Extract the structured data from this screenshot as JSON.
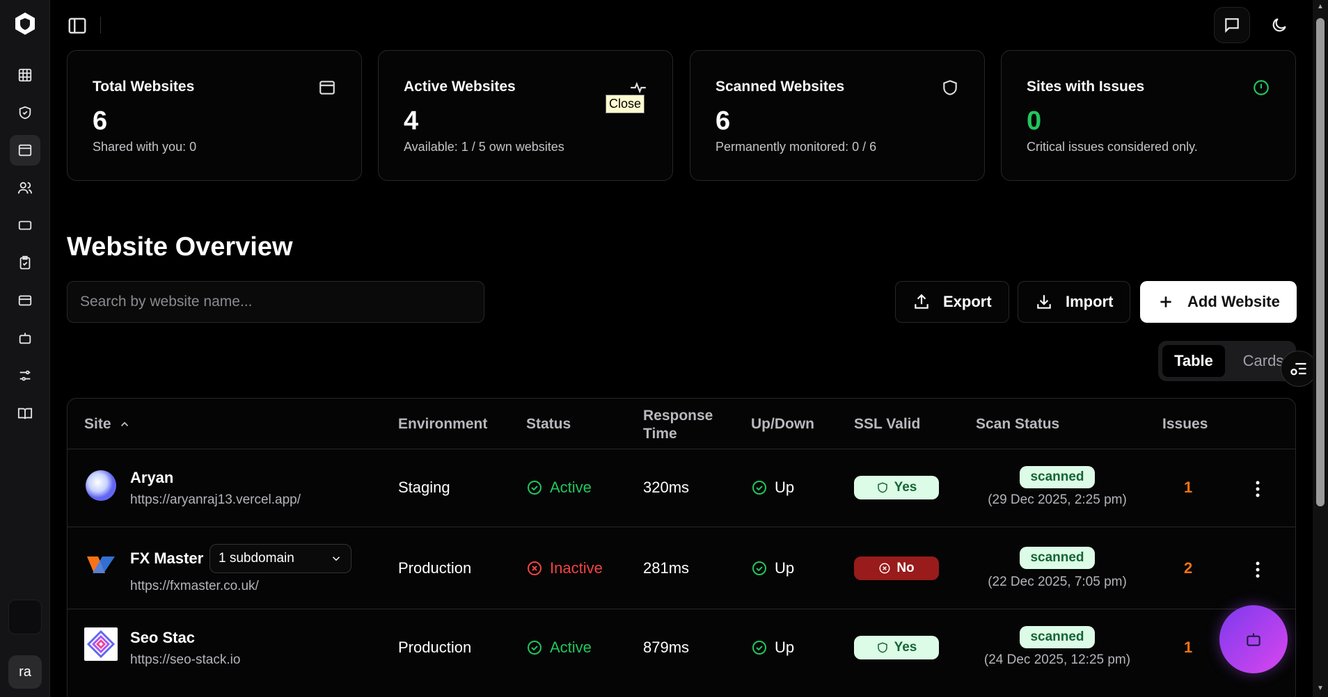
{
  "sidebar": {
    "items": [
      "dashboard",
      "security",
      "websites",
      "users",
      "tickets",
      "tasks",
      "billing",
      "bots",
      "settings",
      "docs"
    ],
    "bottom_box_text": "",
    "avatar_initials": "ra"
  },
  "stats": [
    {
      "title": "Total Websites",
      "value": "6",
      "sub": "Shared with you: 0"
    },
    {
      "title": "Active Websites",
      "value": "4",
      "sub": "Available: 1 / 5 own websites"
    },
    {
      "title": "Scanned Websites",
      "value": "6",
      "sub": "Permanently monitored: 0 / 6"
    },
    {
      "title": "Sites with Issues",
      "value": "0",
      "sub": "Critical issues considered only."
    }
  ],
  "tooltip": "Close",
  "page_title": "Website Overview",
  "search": {
    "placeholder": "Search by website name..."
  },
  "actions": {
    "export": "Export",
    "import": "Import",
    "add": "Add Website"
  },
  "view_toggle": {
    "table": "Table",
    "cards": "Cards"
  },
  "table": {
    "headers": {
      "site": "Site",
      "environment": "Environment",
      "status": "Status",
      "response_time": "Response Time",
      "updown": "Up/Down",
      "ssl": "SSL Valid",
      "scan_status": "Scan Status",
      "issues": "Issues"
    },
    "rows": [
      {
        "name": "Aryan",
        "url": "https://aryanraj13.vercel.app/",
        "environment": "Staging",
        "status": "Active",
        "response": "320ms",
        "updown": "Up",
        "ssl": "Yes",
        "scan": "scanned",
        "scan_date": "(29 Dec 2025, 2:25 pm)",
        "issues": "1"
      },
      {
        "name": "FX Master",
        "subdomain": "1 subdomain",
        "url": "https://fxmaster.co.uk/",
        "environment": "Production",
        "status": "Inactive",
        "response": "281ms",
        "updown": "Up",
        "ssl": "No",
        "scan": "scanned",
        "scan_date": "(22 Dec 2025, 7:05 pm)",
        "issues": "2"
      },
      {
        "name": "Seo Stac",
        "url": "https://seo-stack.io",
        "environment": "Production",
        "status": "Active",
        "response": "879ms",
        "updown": "Up",
        "ssl": "Yes",
        "scan": "scanned",
        "scan_date": "(24 Dec 2025, 12:25 pm)",
        "issues": "1"
      }
    ]
  }
}
